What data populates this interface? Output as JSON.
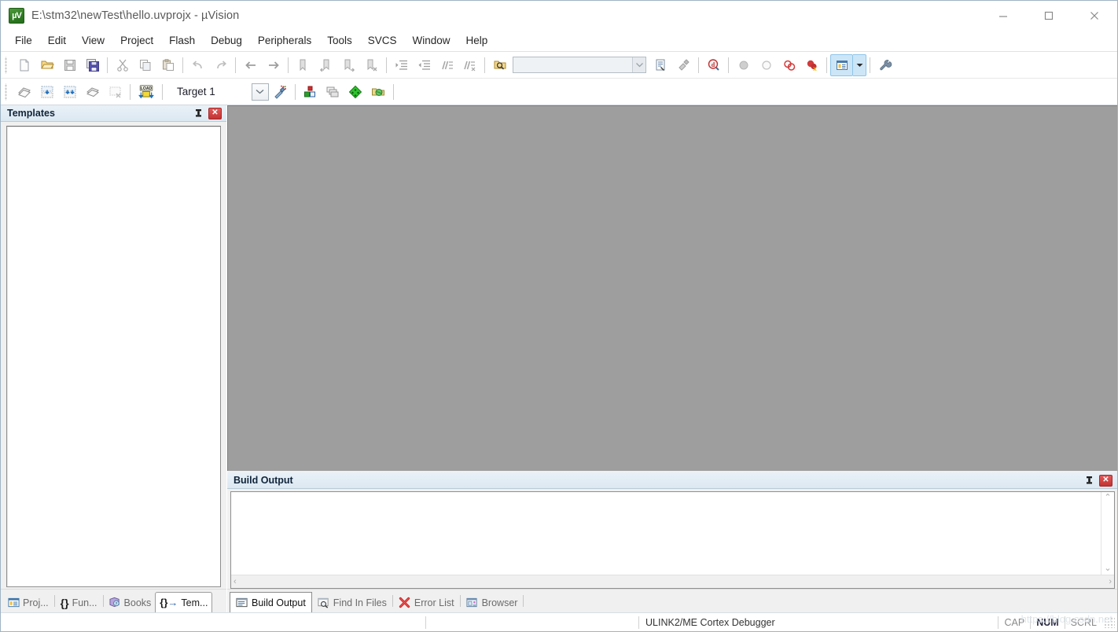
{
  "window": {
    "title": "E:\\stm32\\newTest\\hello.uvprojx - µVision",
    "icon": "uvision-logo-icon",
    "minimize_label": "—",
    "maximize_label": "□",
    "close_label": "✕"
  },
  "menubar": {
    "items": [
      {
        "label": "File"
      },
      {
        "label": "Edit"
      },
      {
        "label": "View"
      },
      {
        "label": "Project"
      },
      {
        "label": "Flash"
      },
      {
        "label": "Debug"
      },
      {
        "label": "Peripherals"
      },
      {
        "label": "Tools"
      },
      {
        "label": "SVCS"
      },
      {
        "label": "Window"
      },
      {
        "label": "Help"
      }
    ]
  },
  "toolbar_main": {
    "buttons": [
      {
        "name": "new-file-icon",
        "title": "New"
      },
      {
        "name": "open-file-icon",
        "title": "Open"
      },
      {
        "name": "save-icon",
        "title": "Save"
      },
      {
        "name": "save-all-icon",
        "title": "Save All"
      },
      {
        "name": "cut-icon",
        "title": "Cut"
      },
      {
        "name": "copy-icon",
        "title": "Copy"
      },
      {
        "name": "paste-icon",
        "title": "Paste"
      },
      {
        "name": "undo-icon",
        "title": "Undo"
      },
      {
        "name": "redo-icon",
        "title": "Redo"
      },
      {
        "name": "navigate-back-icon",
        "title": "Back"
      },
      {
        "name": "navigate-forward-icon",
        "title": "Forward"
      },
      {
        "name": "bookmark-toggle-icon",
        "title": "Insert/Remove Bookmark"
      },
      {
        "name": "bookmark-prev-icon",
        "title": "Previous Bookmark"
      },
      {
        "name": "bookmark-next-icon",
        "title": "Next Bookmark"
      },
      {
        "name": "bookmark-clear-icon",
        "title": "Clear All Bookmarks"
      },
      {
        "name": "indent-right-icon",
        "title": "Indent"
      },
      {
        "name": "indent-left-icon",
        "title": "Outdent"
      },
      {
        "name": "comment-icon",
        "title": "Comment"
      },
      {
        "name": "uncomment-icon",
        "title": "Uncomment"
      },
      {
        "name": "find-in-files-icon",
        "title": "Find in Files"
      }
    ],
    "search_value": "",
    "search_placeholder": "",
    "after_search": [
      {
        "name": "browse-source-icon",
        "title": "Browse"
      },
      {
        "name": "configure-icon",
        "title": "Configure"
      },
      {
        "name": "debug-start-icon",
        "title": "Start/Stop Debug Session"
      },
      {
        "name": "breakpoint-insert-icon",
        "title": "Insert/Remove Breakpoint"
      },
      {
        "name": "breakpoint-enable-icon",
        "title": "Enable/Disable Breakpoint"
      },
      {
        "name": "breakpoint-disable-all-icon",
        "title": "Disable All Breakpoints"
      },
      {
        "name": "breakpoint-kill-all-icon",
        "title": "Kill All Breakpoints"
      },
      {
        "name": "project-window-icon",
        "title": "Project Window"
      },
      {
        "name": "dropdown-arrow-icon",
        "title": "More"
      },
      {
        "name": "options-target-icon",
        "title": "Configure Target"
      }
    ]
  },
  "toolbar_build": {
    "buttons": [
      {
        "name": "translate-icon",
        "title": "Translate"
      },
      {
        "name": "build-icon",
        "title": "Build"
      },
      {
        "name": "rebuild-icon",
        "title": "Rebuild"
      },
      {
        "name": "batch-build-icon",
        "title": "Batch Build"
      },
      {
        "name": "stop-build-icon",
        "title": "Stop Build"
      },
      {
        "name": "download-icon",
        "title": "Download"
      }
    ],
    "target_value": "Target 1",
    "after_target": [
      {
        "name": "target-options-icon",
        "title": "Options for Target"
      },
      {
        "name": "manage-project-items-icon",
        "title": "Manage Project Items"
      },
      {
        "name": "multi-project-icon",
        "title": "Multi-Project"
      },
      {
        "name": "pack-installer-icon",
        "title": "Pack Installer"
      },
      {
        "name": "manage-runtime-env-icon",
        "title": "Manage Run-Time Environment"
      }
    ]
  },
  "left_panel": {
    "caption": "Templates",
    "pin_label": "ᴘ",
    "close_label": "✕",
    "list_items": [],
    "tabs": [
      {
        "label": "Proj...",
        "icon": "project-icon",
        "active": false
      },
      {
        "label": "Fun...",
        "icon": "functions-icon",
        "active": false
      },
      {
        "label": "Books",
        "icon": "books-icon",
        "active": false
      },
      {
        "label": "Tem...",
        "icon": "templates-icon",
        "active": true
      }
    ]
  },
  "build_output": {
    "caption": "Build Output",
    "pin_label": "ᴘ",
    "close_label": "✕",
    "content": "",
    "scroll_up": "⌃",
    "scroll_down": "⌄",
    "scroll_left": "‹",
    "scroll_right": "›"
  },
  "bottom_tabs": [
    {
      "label": "Build Output",
      "icon": "build-output-icon",
      "active": true
    },
    {
      "label": "Find In Files",
      "icon": "find-in-files-icon",
      "active": false
    },
    {
      "label": "Error List",
      "icon": "error-list-icon",
      "active": false
    },
    {
      "label": "Browser",
      "icon": "browser-icon",
      "active": false
    }
  ],
  "statusbar": {
    "debugger": "ULINK2/ME Cortex Debugger",
    "cap": "CAP",
    "num": "NUM",
    "scrl": "SCRL",
    "watermark": "https://blog.csdn.net",
    "watermark2": "net/zidingyidingyi"
  },
  "colors": {
    "accent_blue": "#cde6f7",
    "panel_caption": "#dce8f2",
    "editor_void": "#9e9e9e",
    "close_red": "#c33232",
    "titlebar_text": "#5a5a5a"
  }
}
